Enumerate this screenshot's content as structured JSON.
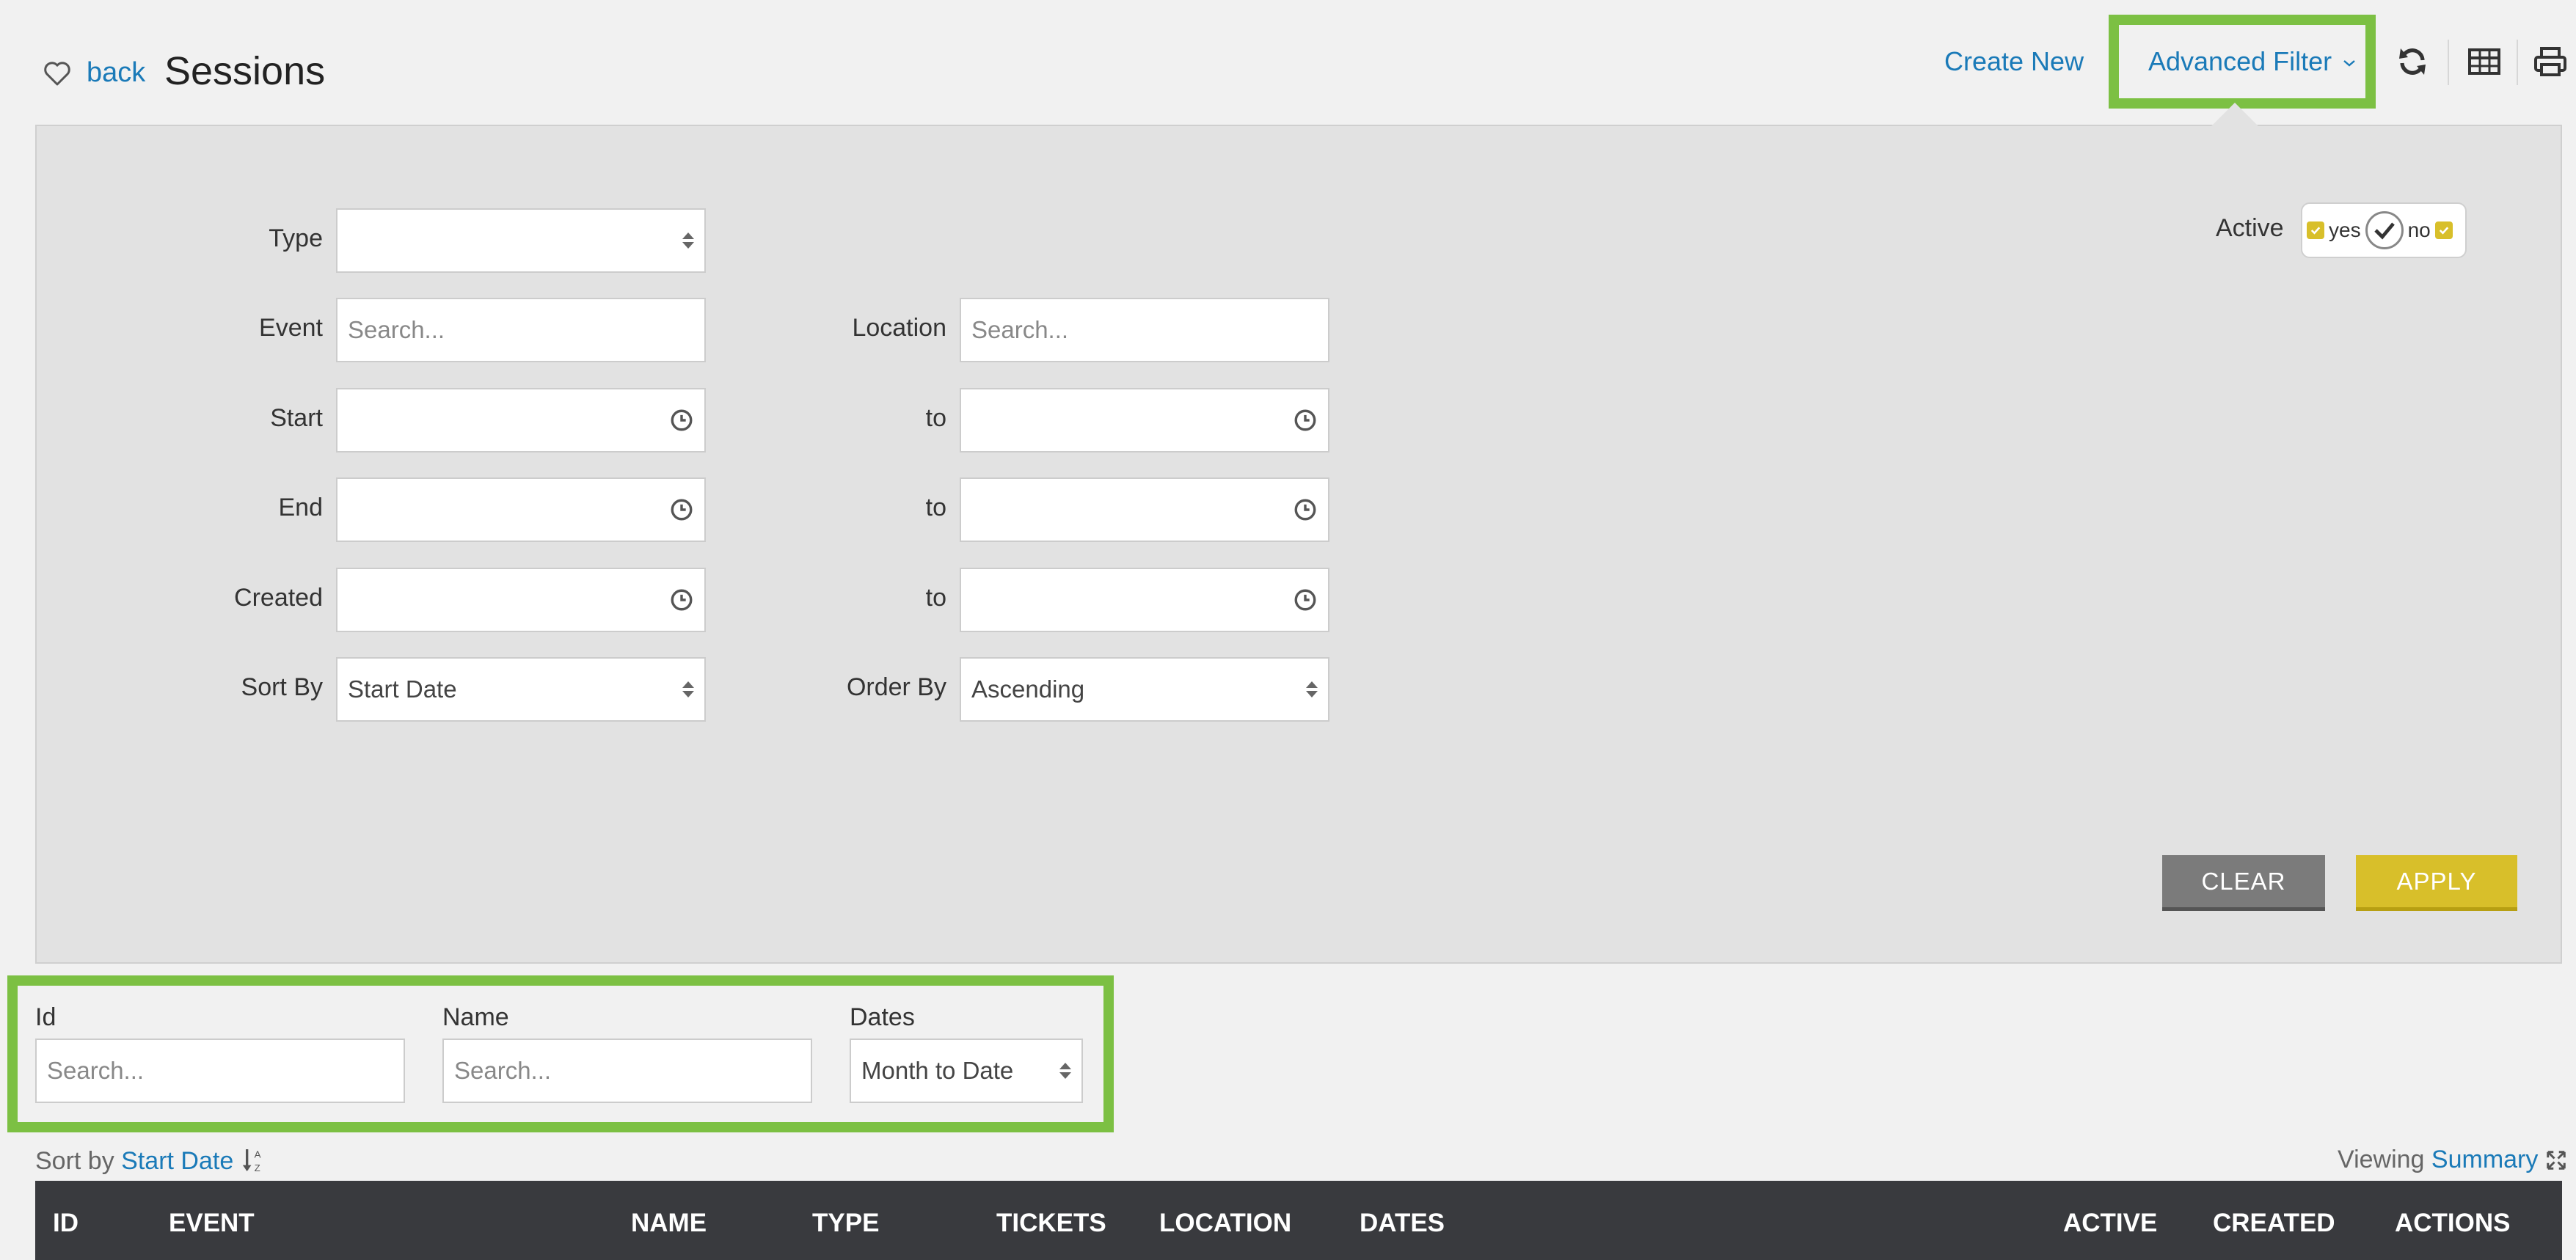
{
  "header": {
    "back_label": "back",
    "title": "Sessions",
    "create_new": "Create New",
    "advanced_filter": "Advanced Filter",
    "highlight_color": "#7cc043"
  },
  "filter": {
    "type_label": "Type",
    "type_value": "",
    "event_label": "Event",
    "event_placeholder": "Search...",
    "location_label": "Location",
    "location_placeholder": "Search...",
    "start_label": "Start",
    "end_label": "End",
    "created_label": "Created",
    "to_label": "to",
    "sort_by_label": "Sort By",
    "sort_by_value": "Start Date",
    "order_by_label": "Order By",
    "order_by_value": "Ascending",
    "active_label": "Active",
    "active_yes": "yes",
    "active_no": "no",
    "clear_button": "CLEAR",
    "apply_button": "APPLY",
    "apply_color": "#d8bf2a",
    "clear_color": "#7b7b7b"
  },
  "quick_filter": {
    "id_label": "Id",
    "id_placeholder": "Search...",
    "name_label": "Name",
    "name_placeholder": "Search...",
    "dates_label": "Dates",
    "dates_value": "Month to Date"
  },
  "sort_row": {
    "sort_by_prefix": "Sort by",
    "sort_by_field": "Start Date",
    "viewing_prefix": "Viewing",
    "viewing_mode": "Summary"
  },
  "table": {
    "columns": [
      "ID",
      "EVENT",
      "NAME",
      "TYPE",
      "TICKETS",
      "LOCATION",
      "DATES",
      "ACTIVE",
      "CREATED",
      "ACTIONS"
    ]
  }
}
